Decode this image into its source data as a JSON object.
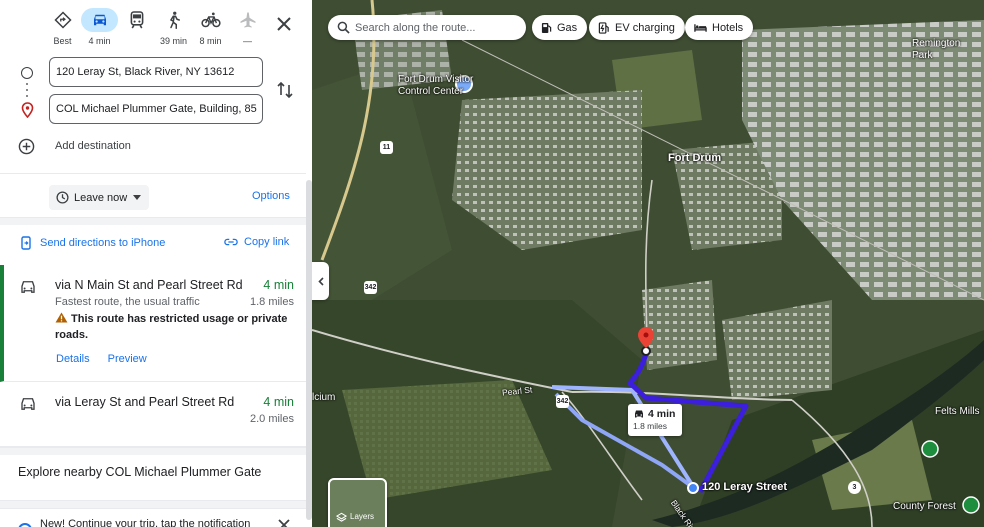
{
  "travel_modes": [
    {
      "name": "Best",
      "label": "Best",
      "icon": "diamond-route-icon"
    },
    {
      "name": "Driving",
      "label": "4 min",
      "icon": "car-icon",
      "active": true
    },
    {
      "name": "Transit",
      "label": "",
      "icon": "train-icon"
    },
    {
      "name": "Walking",
      "label": "39 min",
      "icon": "walk-icon"
    },
    {
      "name": "Cycling",
      "label": "8 min",
      "icon": "bike-icon"
    },
    {
      "name": "Flights",
      "label": "—",
      "icon": "plane-icon"
    }
  ],
  "route_inputs": {
    "origin": "120 Leray St, Black River, NY 13612",
    "destination": "COL Michael Plummer Gate, Building, 85"
  },
  "add_destination": "Add destination",
  "leave_now": "Leave now",
  "options": "Options",
  "share": {
    "send": "Send directions to iPhone",
    "copy": "Copy link"
  },
  "routes": [
    {
      "via": "via N Main St and Pearl Street Rd",
      "time": "4 min",
      "subtitle": "Fastest route, the usual traffic",
      "distance": "1.8 miles",
      "warning": "This route has restricted usage or private roads.",
      "details": "Details",
      "preview": "Preview"
    },
    {
      "via": "via Leray St and Pearl Street Rd",
      "time": "4 min",
      "distance": "2.0 miles"
    }
  ],
  "explore": "Explore nearby COL Michael Plummer Gate",
  "notice": "New! Continue your trip, tap the notification",
  "map": {
    "search_placeholder": "Search along the route...",
    "chips": [
      {
        "label": "Gas",
        "icon": "gas-pump-icon"
      },
      {
        "label": "EV charging",
        "icon": "ev-charger-icon"
      },
      {
        "label": "Hotels",
        "icon": "bed-icon"
      }
    ],
    "labels": {
      "fort_drum_visitor": "Fort Drum Visitor\nControl Center",
      "fort_drum": "Fort Drum",
      "remington_park": "Remington\nPark",
      "pearl_st": "Pearl St",
      "calcium": "lcium",
      "felts_mills": "Felts Mills",
      "county_forest": "County Forest",
      "leray_street": "120 Leray Street",
      "black_river": "Black River"
    },
    "shields": [
      "11",
      "342",
      "342",
      "3"
    ],
    "route_box": {
      "time": "4 min",
      "distance": "1.8 miles"
    },
    "layers": "Layers",
    "colors": {
      "route_primary": "#3b1fdc",
      "route_alt": "#9fb4ff",
      "pin": "#ea4335"
    }
  }
}
